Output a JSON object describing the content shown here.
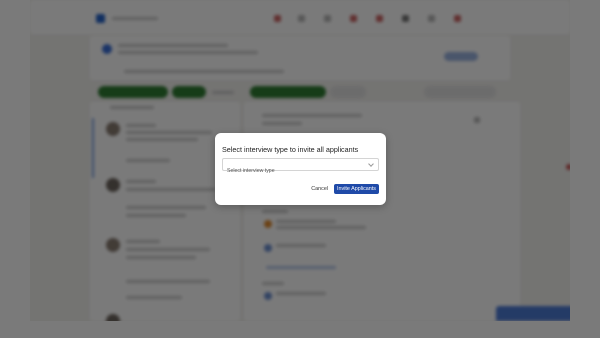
{
  "modal": {
    "title": "Select interview type to invite all applicants",
    "select_placeholder": "Select interview type",
    "cancel_label": "Cancel",
    "invite_label": "Invite Applicants"
  },
  "colors": {
    "primary_button": "#1f4aa8",
    "green_chip": "#2e7d32",
    "backdrop": "#000000"
  },
  "icons": [
    "chevron-down-icon",
    "avatar",
    "brand-logo"
  ]
}
